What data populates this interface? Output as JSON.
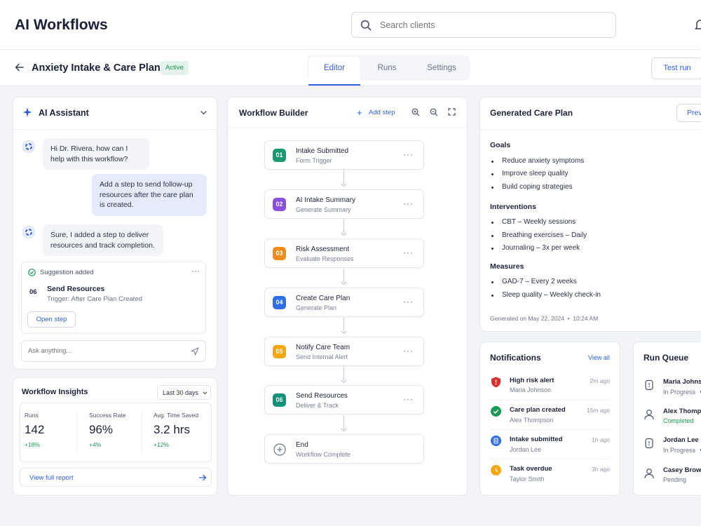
{
  "app": {
    "title": "AI Workflows"
  },
  "search": {
    "placeholder": "Search clients"
  },
  "workflow": {
    "name": "Anxiety Intake & Care Plan",
    "status": "Active",
    "test_run_label": "Test run"
  },
  "tabs": [
    {
      "label": "Editor"
    },
    {
      "label": "Runs"
    },
    {
      "label": "Settings"
    }
  ],
  "assistant": {
    "title": "AI Assistant",
    "messages": [
      {
        "from": "ai",
        "text": "Hi Dr. Rivera, how can I help with this workflow?"
      },
      {
        "from": "user",
        "text": "Add a step to send follow-up resources after the care plan is created."
      },
      {
        "from": "ai",
        "text": "Sure, I added a step to deliver resources and track completion."
      }
    ],
    "suggestion": {
      "label": "Suggestion added",
      "num": "06",
      "title": "Send Resources",
      "trigger": "Trigger: After Care Plan Created",
      "open_label": "Open step"
    },
    "input_placeholder": "Ask anything..."
  },
  "insights": {
    "title": "Workflow Insights",
    "range": "Last 30 days",
    "stats": [
      {
        "label": "Runs",
        "value": "142",
        "change": "+18%"
      },
      {
        "label": "Success Rate",
        "value": "96%",
        "change": "+4%"
      },
      {
        "label": "Avg. Time Saved",
        "value": "3.2 hrs",
        "change": "+12%"
      }
    ],
    "report_label": "View full report"
  },
  "builder": {
    "title": "Workflow Builder",
    "add_step_label": "Add step",
    "steps": [
      {
        "num": "01",
        "title": "Intake Submitted",
        "sub": "Form Trigger",
        "color": "#1a9a6c"
      },
      {
        "num": "02",
        "title": "AI Intake Summary",
        "sub": "Generate Summary",
        "color": "#8b4fe0"
      },
      {
        "num": "03",
        "title": "Risk Assessment",
        "sub": "Evaluate Responses",
        "color": "#f08c1d"
      },
      {
        "num": "04",
        "title": "Create Care Plan",
        "sub": "Generate Plan",
        "color": "#2f6fe8"
      },
      {
        "num": "05",
        "title": "Notify Care Team",
        "sub": "Send Internal Alert",
        "color": "#f5a712"
      },
      {
        "num": "06",
        "title": "Send Resources",
        "sub": "Deliver & Track",
        "color": "#13917a"
      }
    ],
    "end": {
      "title": "End",
      "sub": "Workflow Complete"
    }
  },
  "care_plan": {
    "title": "Generated Care Plan",
    "preview_label": "Previ",
    "sections": [
      {
        "heading": "Goals",
        "items": [
          "Reduce anxiety symptoms",
          "Improve sleep quality",
          "Build coping strategies"
        ]
      },
      {
        "heading": "Interventions",
        "items": [
          "CBT – Weekly sessions",
          "Breathing exercises – Daily",
          "Journaling – 3x per week"
        ]
      },
      {
        "heading": "Measures",
        "items": [
          "GAD-7 – Every 2 weeks",
          "Sleep quality – Weekly check-in"
        ]
      }
    ],
    "generated": "Generated on May 22, 2024  •  10:24 AM"
  },
  "notifications": {
    "title": "Notifications",
    "view_all": "View all",
    "items": [
      {
        "title": "High risk alert",
        "name": "Maria Johnson",
        "time": "2m ago",
        "icon": "shield-alert-icon",
        "color": "#d9312b"
      },
      {
        "title": "Care plan created",
        "name": "Alex Thompson",
        "time": "15m ago",
        "icon": "check-circle-icon",
        "color": "#1a9a55"
      },
      {
        "title": "Intake submitted",
        "name": "Jordan Lee",
        "time": "1h ago",
        "icon": "document-icon",
        "color": "#2f6fe8"
      },
      {
        "title": "Task overdue",
        "name": "Taylor Smith",
        "time": "3h ago",
        "icon": "clock-icon",
        "color": "#f5a712"
      }
    ]
  },
  "run_queue": {
    "title": "Run Queue",
    "items": [
      {
        "name": "Maria Johnso",
        "status": "In Progress"
      },
      {
        "name": "Alex Thomps",
        "status": "Completed"
      },
      {
        "name": "Jordan Lee",
        "status": "In Progress"
      },
      {
        "name": "Casey Brown",
        "status": "Pending"
      }
    ]
  },
  "colors": {
    "accent": "#2f5fe0",
    "success": "#1a9a55",
    "background": "#f3f4f8"
  }
}
